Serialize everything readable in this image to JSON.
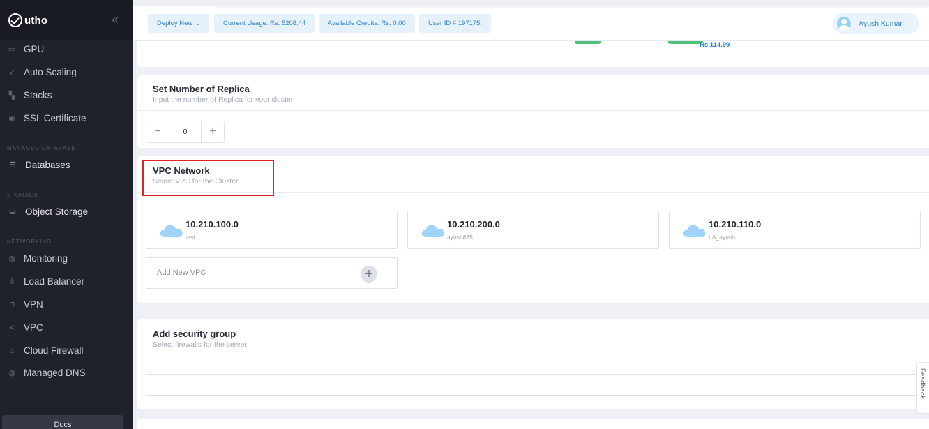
{
  "brand": {
    "name": "utho"
  },
  "sidebar": {
    "items": [
      {
        "label": "GPU",
        "icon": "gpu-icon"
      },
      {
        "label": "Auto Scaling",
        "icon": "rocket-icon"
      },
      {
        "label": "Stacks",
        "icon": "stacks-icon"
      },
      {
        "label": "SSL Certificate",
        "icon": "certificate-icon"
      },
      {
        "label": "Databases",
        "icon": "database-icon"
      },
      {
        "label": "Object Storage",
        "icon": "storage-icon"
      },
      {
        "label": "Monitoring",
        "icon": "globe-icon"
      },
      {
        "label": "Load Balancer",
        "icon": "network-icon"
      },
      {
        "label": "VPN",
        "icon": "lock-icon"
      },
      {
        "label": "VPC",
        "icon": "share-icon"
      },
      {
        "label": "Cloud Firewall",
        "icon": "firewall-icon"
      },
      {
        "label": "Managed DNS",
        "icon": "dns-icon"
      }
    ],
    "sections": {
      "managed_database": "MANAGED DATABASE",
      "storage": "STORAGE",
      "networking": "NETWORKING"
    },
    "docs_label": "Docs"
  },
  "topbar": {
    "deploy_label": "Deploy New",
    "current_usage": "Current Usage: Rs. 5208.44",
    "available_credits": "Available Credits: Rs. 0.00",
    "user_id": "User ID # 197175.",
    "user_name": "Ayush Kumar"
  },
  "previous": {
    "price": "Rs.114.99"
  },
  "replica": {
    "title": "Set Number of Replica",
    "subtitle": "Input the number of Replica for your cluster",
    "value": "0",
    "minus": "−",
    "plus": "+"
  },
  "vpc": {
    "title": "VPC Network",
    "subtitle": "Select VPC for the Cluster",
    "options": [
      {
        "ip": "10.210.100.0",
        "name": "test"
      },
      {
        "ip": "10.210.200.0",
        "name": "ayush885"
      },
      {
        "ip": "10.210.110.0",
        "name": "LA_ayush"
      }
    ],
    "add_label": "Add New VPC",
    "add_icon": "+"
  },
  "security": {
    "title": "Add security group",
    "subtitle": "Select firewalls for the server"
  },
  "feedback_label": "Feedback",
  "colors": {
    "accent": "#2e82cc",
    "sidebar": "#1f222b",
    "highlight": "#e02424",
    "cloud": "#9fd4f8"
  }
}
